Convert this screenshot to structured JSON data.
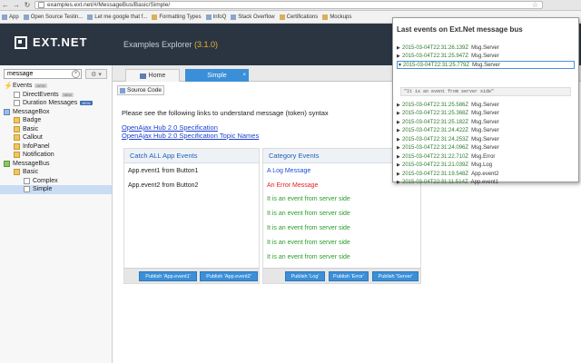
{
  "browser": {
    "url": "examples.ext.net/#/MessageBus/Basic/Simple/",
    "bookmarks": [
      "App",
      "Open Source Testin...",
      "Let me google that f...",
      "Formatting Types",
      "InfoQ",
      "Stack Overflow",
      "Certifications",
      "Mockups"
    ]
  },
  "header": {
    "logo": "EXT.NET",
    "title_prefix": "Examples Explorer",
    "version": "(3.1.0)"
  },
  "sidebar": {
    "search_value": "message",
    "tree": [
      {
        "label": "Events",
        "icon": "bolt",
        "indent": 0,
        "badge": "NEW"
      },
      {
        "label": "DirectEvents",
        "icon": "page",
        "indent": 1,
        "badge": "NEW"
      },
      {
        "label": "Duration Messages",
        "icon": "page",
        "indent": 1,
        "badge": "NEW"
      },
      {
        "label": "MessageBox",
        "icon": "grid",
        "indent": 0,
        "badge": ""
      },
      {
        "label": "Badge",
        "icon": "folder",
        "indent": 1,
        "badge": ""
      },
      {
        "label": "Basic",
        "icon": "folder",
        "indent": 1,
        "badge": ""
      },
      {
        "label": "Callout",
        "icon": "folder",
        "indent": 1,
        "badge": ""
      },
      {
        "label": "InfoPanel",
        "icon": "folder",
        "indent": 1,
        "badge": ""
      },
      {
        "label": "Notification",
        "icon": "folder",
        "indent": 1,
        "badge": ""
      },
      {
        "label": "MessageBus",
        "icon": "green",
        "indent": 0,
        "badge": ""
      },
      {
        "label": "Basic",
        "icon": "folder",
        "indent": 1,
        "badge": ""
      },
      {
        "label": "Complex",
        "icon": "page",
        "indent": 2,
        "badge": ""
      },
      {
        "label": "Simple",
        "icon": "page",
        "indent": 2,
        "badge": "",
        "selected": true
      }
    ]
  },
  "tabs": {
    "home": "Home",
    "simple": "Simple"
  },
  "main": {
    "source_button": "Source Code",
    "intro": "Please see the following links to understand message (token) syntax",
    "link1": "OpenAjax Hub 2.0 Specification",
    "link2": "OpenAjax Hub 2.0 Specification Topic Names",
    "left_panel": {
      "title": "Catch ALL App Events",
      "lines": [
        "App.event1 from Button1",
        "App.event2 from Button2"
      ],
      "buttons": [
        "Publish 'App.event1'",
        "Publish 'App.event2'"
      ]
    },
    "right_panel": {
      "title": "Category Events",
      "lines": [
        {
          "text": "A Log Message",
          "color": "blue"
        },
        {
          "text": "An Error Message",
          "color": "red"
        },
        {
          "text": "It is an event from server side",
          "color": "green"
        },
        {
          "text": "It is an event from server side",
          "color": "green"
        },
        {
          "text": "It is an event from server side",
          "color": "green"
        },
        {
          "text": "It is an event from server side",
          "color": "green"
        },
        {
          "text": "It is an event from server side",
          "color": "green"
        }
      ],
      "buttons": [
        "Publish 'Log'",
        "Publish 'Error'",
        "Publish 'Server'"
      ]
    }
  },
  "popup": {
    "title": "Last events on Ext.Net message bus",
    "events": [
      {
        "time": "2015-03-04T22:31:26.139Z",
        "name": "Msg.Server",
        "open": false
      },
      {
        "time": "2015-03-04T22:31:25.947Z",
        "name": "Msg.Server",
        "open": false
      },
      {
        "time": "2015-03-04T22:31:25.779Z",
        "name": "Msg.Server",
        "open": true
      },
      {
        "time": "2015-03-04T22:31:25.586Z",
        "name": "Msg.Server",
        "open": false
      },
      {
        "time": "2015-03-04T22:31:25.368Z",
        "name": "Msg.Server",
        "open": false
      },
      {
        "time": "2015-03-04T22:31:25.182Z",
        "name": "Msg.Server",
        "open": false
      },
      {
        "time": "2015-03-04T22:31:24.422Z",
        "name": "Msg.Server",
        "open": false
      },
      {
        "time": "2015-03-04T22:31:24.253Z",
        "name": "Msg.Server",
        "open": false
      },
      {
        "time": "2015-03-04T22:31:24.096Z",
        "name": "Msg.Server",
        "open": false
      },
      {
        "time": "2015-03-04T22:31:22.710Z",
        "name": "Msg.Error",
        "open": false
      },
      {
        "time": "2015-03-04T22:31:21.039Z",
        "name": "Msg.Log",
        "open": false
      },
      {
        "time": "2015-03-04T22:31:19.548Z",
        "name": "App.event2",
        "open": false
      },
      {
        "time": "2015-03-04T22:31:11.514Z",
        "name": "App.event1",
        "open": false
      }
    ],
    "detail": "\"It is an event from server side\""
  }
}
